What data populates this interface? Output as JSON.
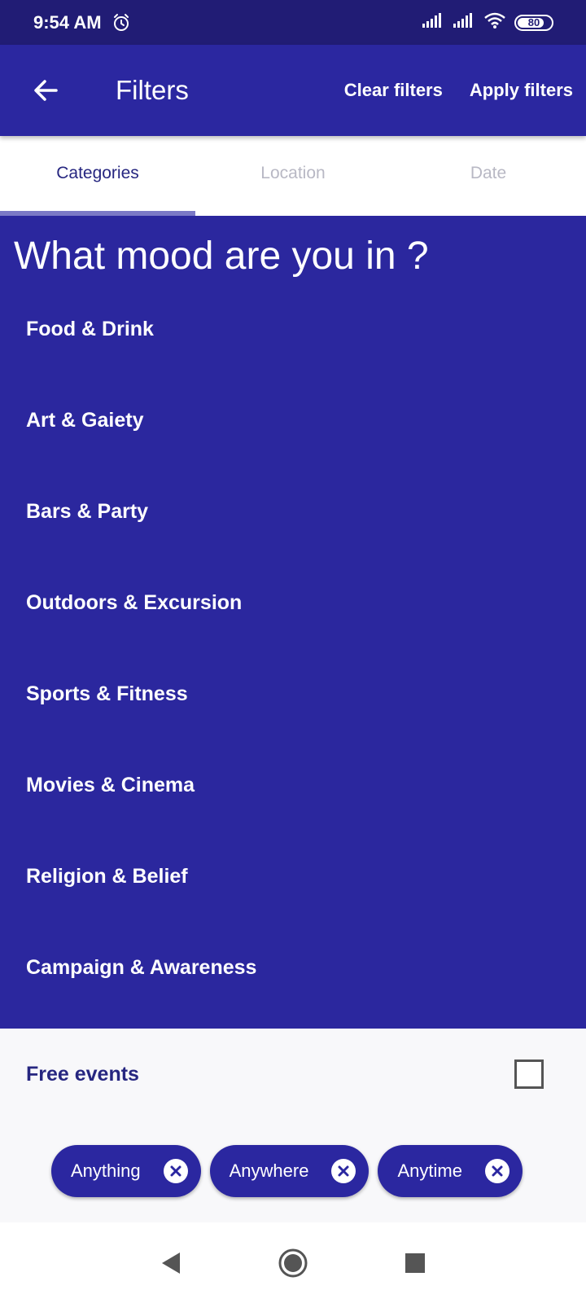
{
  "status_bar": {
    "time": "9:54 AM",
    "battery": "80",
    "battery_level": 0.8,
    "icons": [
      "alarm-icon",
      "signal-icon",
      "signal-icon",
      "wifi-icon",
      "battery-icon"
    ]
  },
  "app_bar": {
    "title": "Filters",
    "clear_label": "Clear filters",
    "apply_label": "Apply filters"
  },
  "tabs": [
    {
      "label": "Categories",
      "active": true
    },
    {
      "label": "Location",
      "active": false
    },
    {
      "label": "Date",
      "active": false
    }
  ],
  "mood": {
    "heading": "What mood are you in ?",
    "categories": [
      "Food & Drink",
      "Art & Gaiety",
      "Bars & Party",
      "Outdoors & Excursion",
      "Sports & Fitness",
      "Movies & Cinema",
      "Religion & Belief",
      "Campaign & Awareness"
    ]
  },
  "free_events": {
    "label": "Free events",
    "checked": false
  },
  "chips": [
    "Anything",
    "Anywhere",
    "Anytime"
  ],
  "colors": {
    "primary": "#2b27a0",
    "status_bar": "#211c75",
    "tab_active": "#262680",
    "tab_inactive": "#b8b8c4",
    "tab_indicator": "#7b79c6"
  }
}
